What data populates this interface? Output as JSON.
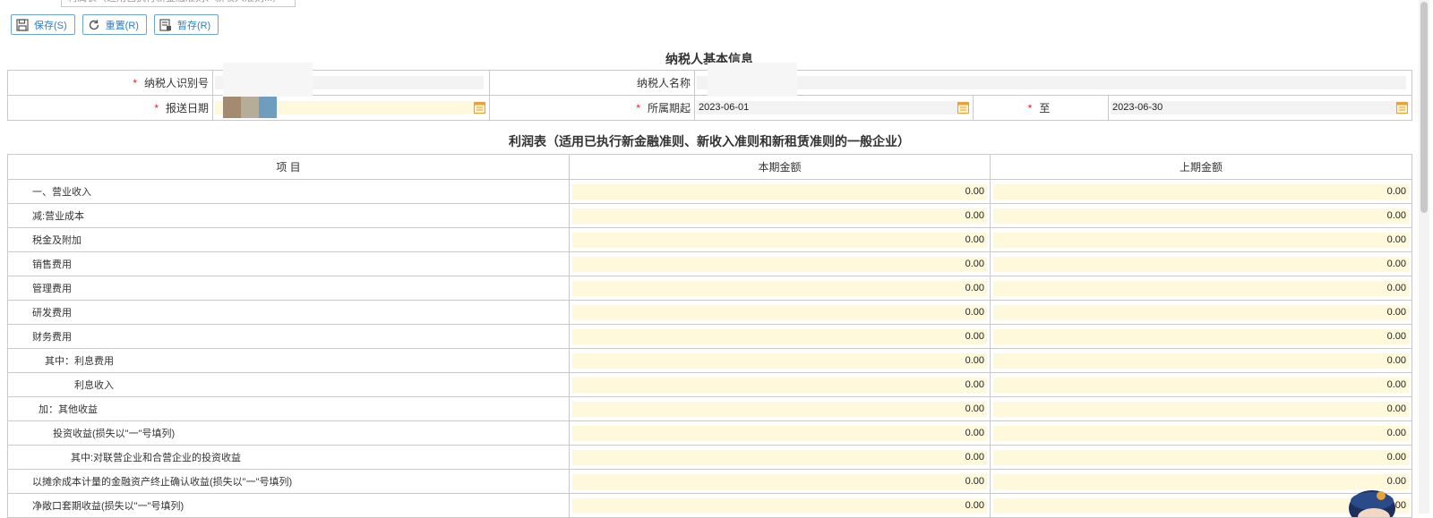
{
  "top_dropdown_text": "利润表（适用已执行新金融准则、新收入准则...）",
  "toolbar": {
    "save_label": "保存(S)",
    "reset_label": "重置(R)",
    "draft_label": "暂存(R)"
  },
  "basic_info": {
    "title": "纳税人基本信息",
    "taxpayer_id_label": "纳税人识别号",
    "taxpayer_name_label": "纳税人名称",
    "report_date_label": "报送日期",
    "period_start_label": "所属期起",
    "period_start_value": "2023-06-01",
    "period_end_label": "至",
    "period_end_value": "2023-06-30",
    "required_mark": "*"
  },
  "statement": {
    "title": "利润表（适用已执行新金融准则、新收入准则和新租赁准则的一般企业）",
    "columns": [
      "项 目",
      "本期金额",
      "上期金额"
    ],
    "rows": [
      {
        "item": "一、营业收入",
        "current": "0.00",
        "previous": "0.00"
      },
      {
        "item": "减:营业成本",
        "current": "0.00",
        "previous": "0.00"
      },
      {
        "item": "税金及附加",
        "current": "0.00",
        "previous": "0.00"
      },
      {
        "item": "销售费用",
        "current": "0.00",
        "previous": "0.00"
      },
      {
        "item": "管理费用",
        "current": "0.00",
        "previous": "0.00"
      },
      {
        "item": "研发费用",
        "current": "0.00",
        "previous": "0.00"
      },
      {
        "item": "财务费用",
        "current": "0.00",
        "previous": "0.00"
      },
      {
        "item": "其中：利息费用",
        "current": "0.00",
        "previous": "0.00"
      },
      {
        "item": "利息收入",
        "current": "0.00",
        "previous": "0.00"
      },
      {
        "item": "加：其他收益",
        "current": "0.00",
        "previous": "0.00"
      },
      {
        "item": "投资收益(损失以\"一\"号填列)",
        "current": "0.00",
        "previous": "0.00"
      },
      {
        "item": "其中:对联营企业和合营企业的投资收益",
        "current": "0.00",
        "previous": "0.00"
      },
      {
        "item": "以摊余成本计量的金融资产终止确认收益(损失以\"一\"号填列)",
        "current": "0.00",
        "previous": "0.00"
      },
      {
        "item": "净敞口套期收益(损失以\"一\"号填列)",
        "current": "0.00",
        "previous": "00"
      }
    ]
  },
  "colors": {
    "accent": "#2d7dc5",
    "input_yellow": "#fff9dc",
    "required_red": "#e02020",
    "border": "#c9c9c9"
  }
}
